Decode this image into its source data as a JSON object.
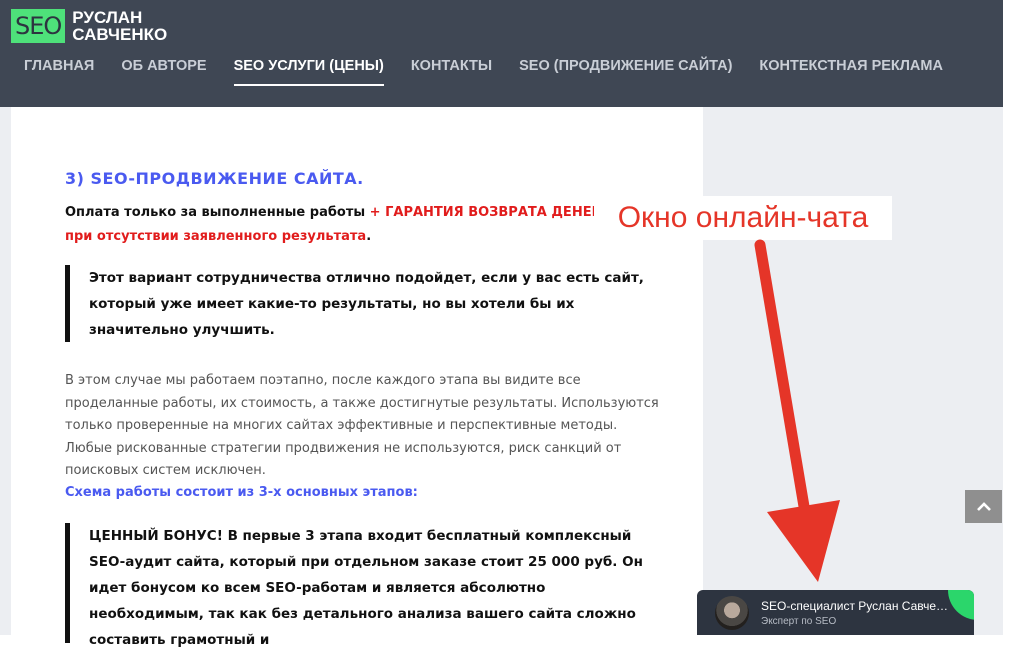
{
  "header": {
    "logo_badge": "SEO",
    "logo_line1": "РУСЛАН",
    "logo_line2": "САВЧЕНКО",
    "nav": [
      {
        "label": "ГЛАВНАЯ"
      },
      {
        "label": "ОБ АВТОРЕ"
      },
      {
        "label": "SEO УСЛУГИ (ЦЕНЫ)"
      },
      {
        "label": "КОНТАКТЫ"
      },
      {
        "label": "SEO (ПРОДВИЖЕНИЕ САЙТА)"
      },
      {
        "label": "КОНТЕКСТНАЯ РЕКЛАМА"
      }
    ],
    "active_nav": "SEO УСЛУГИ (ЦЕНЫ)"
  },
  "article": {
    "section_title": "3) SEO-ПРОДВИЖЕНИЕ САЙТА.",
    "payment_text": "Оплата только за выполненные работы",
    "payment_plus": " + ",
    "payment_guarantee": "ГАРАНТИЯ ВОЗВРАТА ДЕНЕГ при отсутствии заявленного результата",
    "payment_end": ".",
    "quote1": "Этот вариант сотрудничества отлично подойдет, если у вас есть сайт, который уже имеет какие-то результаты, но вы хотели бы их значительно улучшить.",
    "paragraph": "В этом случае мы работаем поэтапно, после каждого этапа вы видите все проделанные работы, их стоимость, а также достигнутые результаты. Используются только проверенные на многих сайтах эффективные и перспективные методы. Любые рискованные стратегии продвижения не используются, риск санкций от поисковых систем исключен.",
    "scheme": "Схема работы состоит из 3-х основных этапов:",
    "quote2": "ЦЕННЫЙ БОНУС! В первые 3 этапа входит бесплатный комплексный SEO-аудит сайта, который при отдельном заказе стоит 25 000 руб. Он идет бонусом ко всем SEO-работам и является абсолютно необходимым, так как без детального анализа вашего сайта сложно составить грамотный и"
  },
  "annotation": {
    "label": "Окно онлайн-чата",
    "color": "#e53528"
  },
  "chat": {
    "name": "SEO-специалист Руслан Савченко",
    "subtitle": "Эксперт по SEO"
  },
  "icons": {
    "scroll_top": "chevron-up-icon",
    "chat_avatar": "avatar"
  },
  "colors": {
    "header_bg": "#3f4754",
    "logo_green": "#4ee17a",
    "accent_blue": "#4a5af0",
    "accent_red": "#e11c1c",
    "chat_bg": "#2d3440",
    "online_green": "#2bd66b"
  }
}
